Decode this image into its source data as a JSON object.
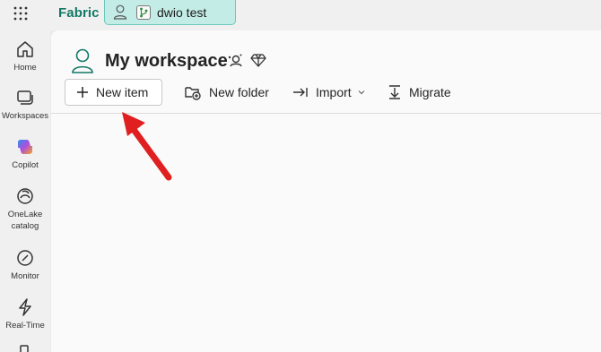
{
  "topbar": {
    "brand": "Fabric",
    "workspace_chip_label": "dwio test"
  },
  "rail": {
    "items": [
      {
        "label": "Home",
        "icon": "home-icon"
      },
      {
        "label": "Workspaces",
        "icon": "workspaces-icon"
      },
      {
        "label": "Copilot",
        "icon": "copilot-icon"
      },
      {
        "label": "OneLake",
        "label2": "catalog",
        "icon": "onelake-catalog-icon"
      },
      {
        "label": "Monitor",
        "icon": "monitor-icon"
      },
      {
        "label": "Real-Time",
        "icon": "real-time-icon"
      }
    ]
  },
  "main": {
    "title": "My workspace",
    "toolbar": {
      "new_item": "New item",
      "new_folder": "New folder",
      "import": "Import",
      "migrate": "Migrate"
    }
  },
  "colors": {
    "brand": "#117865",
    "chip_bg": "#c4ece6",
    "annotation_arrow": "#e02020"
  }
}
